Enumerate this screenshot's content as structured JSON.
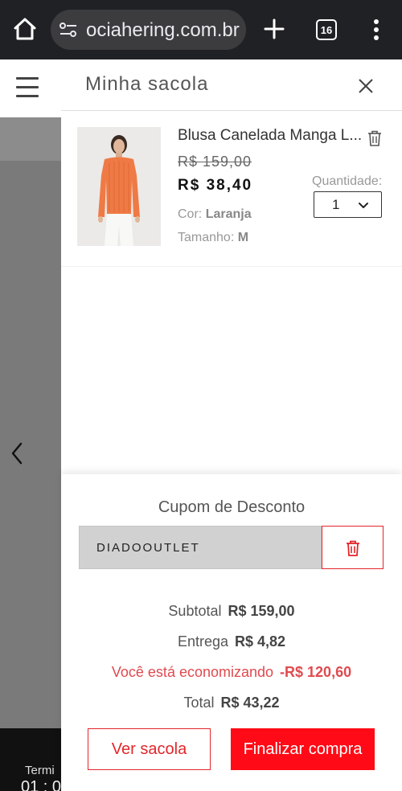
{
  "browser": {
    "url": "ociahering.com.br",
    "tab_count": "16"
  },
  "background_page": {
    "footer_text_1": "Termi",
    "footer_text_2": "01 : 0"
  },
  "cart": {
    "title": "Minha sacola",
    "item": {
      "name": "Blusa Canelada Manga L...",
      "old_price": "R$ 159,00",
      "new_price": "R$ 38,40",
      "color_label": "Cor:",
      "color_value": "Laranja",
      "size_label": "Tamanho:",
      "size_value": "M",
      "quantity_label": "Quantidade:",
      "quantity_value": "1"
    },
    "coupon": {
      "title": "Cupom de Desconto",
      "code": "DIADOOUTLET"
    },
    "summary": {
      "subtotal_label": "Subtotal",
      "subtotal_value": "R$ 159,00",
      "shipping_label": "Entrega",
      "shipping_value": "R$ 4,82",
      "savings_label": "Você está economizando",
      "savings_value": "-R$ 120,60",
      "total_label": "Total",
      "total_value": "R$ 43,22"
    },
    "buttons": {
      "view_cart": "Ver sacola",
      "checkout": "Finalizar compra"
    }
  },
  "colors": {
    "accent_red": "#ff0a16",
    "savings_red": "#e04a4f",
    "browser_bar": "#202124",
    "product_orange": "#ef7a45"
  }
}
